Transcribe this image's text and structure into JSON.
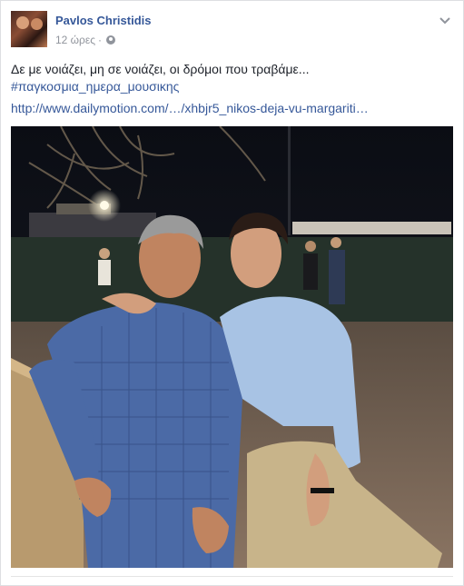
{
  "post": {
    "author": "Pavlos Christidis",
    "time": "12 ώρες",
    "separator": "·",
    "privacy_icon": "globe-icon",
    "text_line_1": "Δε με νοιάζει, μη σε νοιάζει, οι δρόμοι που τραβάμε...",
    "hashtag": "#παγκοσμια_ημερα_μουσικης",
    "link": "http://www.dailymotion.com/…/xhbjr5_nikos-deja-vu-margariti…",
    "options_icon": "chevron-down-icon"
  },
  "colors": {
    "link": "#365899",
    "meta": "#90949c",
    "text": "#1d2129",
    "background": "#e9ebee"
  }
}
